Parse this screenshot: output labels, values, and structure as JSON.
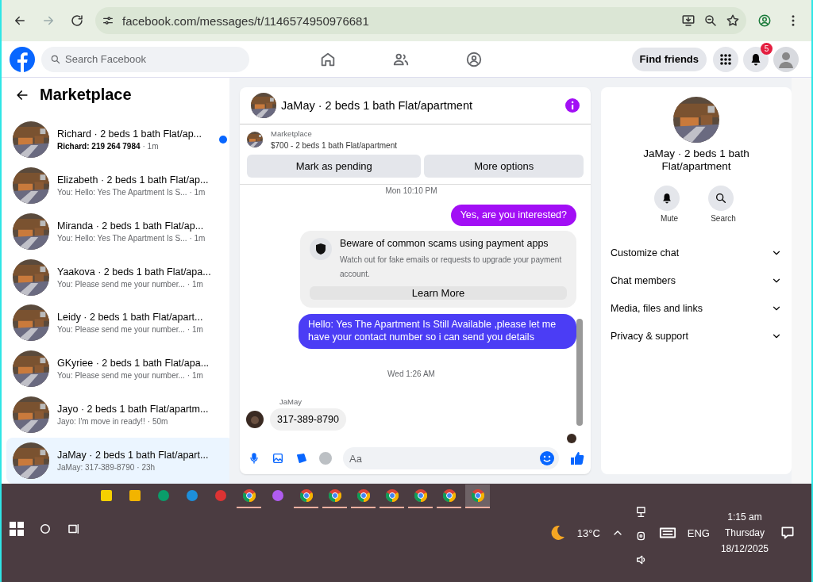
{
  "browser": {
    "url": "facebook.com/messages/t/1146574950976681"
  },
  "header": {
    "search_placeholder": "Search Facebook",
    "find_friends": "Find friends",
    "notification_count": "5"
  },
  "sidebar": {
    "title": "Marketplace",
    "conversations": [
      {
        "title": "Richard · 2 beds 1 bath Flat/ap...",
        "preview": "Richard: 219 264 7984",
        "time": "· 1m",
        "unread": true,
        "selected": false
      },
      {
        "title": "Elizabeth · 2 beds 1 bath Flat/ap...",
        "preview": "You: Hello: Yes The Apartment Is S...",
        "time": "· 1m",
        "unread": false,
        "selected": false
      },
      {
        "title": "Miranda · 2 beds 1 bath Flat/ap...",
        "preview": "You: Hello: Yes The Apartment Is S...",
        "time": "· 1m",
        "unread": false,
        "selected": false
      },
      {
        "title": "Yaakova · 2 beds 1 bath Flat/apa...",
        "preview": "You: Please send me your number...",
        "time": "· 1m",
        "unread": false,
        "selected": false
      },
      {
        "title": "Leidy · 2 beds 1 bath Flat/apart...",
        "preview": "You: Please send me your number...",
        "time": "· 1m",
        "unread": false,
        "selected": false
      },
      {
        "title": "GKyriee · 2 beds 1 bath Flat/apa...",
        "preview": "You: Please send me your number...",
        "time": "· 1m",
        "unread": false,
        "selected": false
      },
      {
        "title": "Jayo · 2 beds 1 bath Flat/apartm...",
        "preview": "Jayo: I'm move in ready!!",
        "time": "· 50m",
        "unread": false,
        "selected": false
      },
      {
        "title": "JaMay · 2 beds 1 bath Flat/apart...",
        "preview": "JaMay: 317-389-8790",
        "time": "· 23h",
        "unread": false,
        "selected": true
      }
    ]
  },
  "chat": {
    "title": "JaMay · 2 beds 1 bath Flat/apartment",
    "listing_label": "Marketplace",
    "listing_title": "$700 - 2 beds 1 bath Flat/apartment",
    "actions": [
      "Mark as pending",
      "More options"
    ],
    "messages": [
      {
        "kind": "timestamp",
        "text": "Mon 10:10 PM"
      },
      {
        "kind": "outgoing",
        "text": "Yes, are you interested?",
        "color": "#a20ff5"
      },
      {
        "kind": "notice",
        "title": "Beware of common scams using payment apps",
        "text": "Watch out for fake emails or requests to upgrade your payment account.",
        "button": "Learn More"
      },
      {
        "kind": "outgoing",
        "text": "Hello: Yes The Apartment Is Still Available ,please let me have your contact number so i can send you details",
        "color": "#4b3df5"
      },
      {
        "kind": "timestamp",
        "text": "Wed 1:26 AM"
      },
      {
        "kind": "incoming",
        "sender": "JaMay",
        "text": "317-389-8790"
      }
    ],
    "composer_placeholder": "Aa"
  },
  "details": {
    "title": "JaMay · 2 beds 1 bath Flat/apartment",
    "actions": [
      "Mute",
      "Search"
    ],
    "sections": [
      "Customize chat",
      "Chat members",
      "Media, files and links",
      "Privacy & support"
    ]
  },
  "taskbar": {
    "temperature": "13°C",
    "language": "ENG",
    "time": "1:15 am",
    "day": "Thursday",
    "date": "18/12/2025"
  }
}
